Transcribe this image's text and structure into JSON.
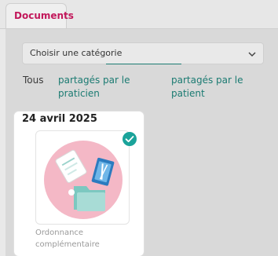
{
  "tabs": [
    {
      "label": "Documents",
      "active": true
    }
  ],
  "category_select": {
    "placeholder": "Choisir une catégorie"
  },
  "filters": {
    "all": "Tous",
    "shared_by_practitioner": "partagés par le praticien",
    "shared_by_patient": "partagés par le patient"
  },
  "documents": [
    {
      "date": "24 avril 2025",
      "title": "Ordonnance complémentaire",
      "selected": true
    }
  ],
  "colors": {
    "accent": "#c2185b",
    "link": "#1b7b72",
    "check": "#1aa39a",
    "thumb_circle": "#f4b8c6"
  }
}
